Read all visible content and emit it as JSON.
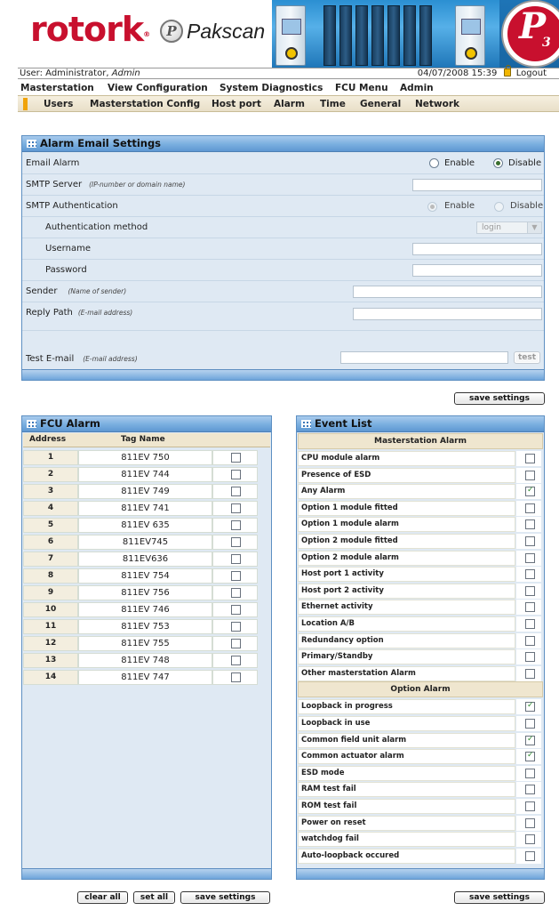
{
  "brand": {
    "rotork": "rotork",
    "pak_letter": "P",
    "pakscan": "Pakscan",
    "p3": "P",
    "p3_sub": "3"
  },
  "userbar": {
    "user_text": "User: Administrator, ",
    "user_name": "Admin",
    "datetime": "04/07/2008 15:39",
    "logout": "Logout"
  },
  "menu": [
    "Masterstation",
    "View Configuration",
    "System Diagnostics",
    "FCU Menu",
    "Admin"
  ],
  "submenu": [
    "Users",
    "Masterstation Config",
    "Host port",
    "Alarm",
    "Time",
    "General",
    "Network"
  ],
  "email": {
    "title": "Alarm Email Settings",
    "email_alarm": "Email Alarm",
    "enable": "Enable",
    "disable": "Disable",
    "smtp_server": "SMTP Server",
    "smtp_server_hint": "(IP-number or domain name)",
    "smtp_auth": "SMTP Authentication",
    "auth_method": "Authentication method",
    "auth_method_value": "login",
    "username": "Username",
    "password": "Password",
    "sender": "Sender",
    "sender_hint": "(Name of sender)",
    "reply_path": "Reply Path",
    "reply_hint": "(E-mail address)",
    "test_email": "Test E-mail",
    "test_hint": "(E-mail address)",
    "test_btn": "test",
    "email_alarm_state": "disable",
    "smtp_auth_state": "enable"
  },
  "save_settings": "save settings",
  "clear_all": "clear all",
  "set_all": "set all",
  "fcu": {
    "title": "FCU Alarm",
    "col_address": "Address",
    "col_tag": "Tag Name",
    "rows": [
      {
        "addr": "1",
        "tag": "811EV 750",
        "checked": false
      },
      {
        "addr": "2",
        "tag": "811EV 744",
        "checked": false
      },
      {
        "addr": "3",
        "tag": "811EV 749",
        "checked": false
      },
      {
        "addr": "4",
        "tag": "811EV 741",
        "checked": false
      },
      {
        "addr": "5",
        "tag": "811EV 635",
        "checked": false
      },
      {
        "addr": "6",
        "tag": "811EV745",
        "checked": false
      },
      {
        "addr": "7",
        "tag": "811EV636",
        "checked": false
      },
      {
        "addr": "8",
        "tag": "811EV 754",
        "checked": false
      },
      {
        "addr": "9",
        "tag": "811EV 756",
        "checked": false
      },
      {
        "addr": "10",
        "tag": "811EV 746",
        "checked": false
      },
      {
        "addr": "11",
        "tag": "811EV 753",
        "checked": false
      },
      {
        "addr": "12",
        "tag": "811EV 755",
        "checked": false
      },
      {
        "addr": "13",
        "tag": "811EV 748",
        "checked": false
      },
      {
        "addr": "14",
        "tag": "811EV 747",
        "checked": false
      }
    ]
  },
  "events": {
    "title": "Event List",
    "groups": [
      {
        "heading": "Masterstation Alarm",
        "items": [
          {
            "label": "CPU module alarm",
            "checked": false
          },
          {
            "label": "Presence of ESD",
            "checked": false
          },
          {
            "label": "Any Alarm",
            "checked": true
          },
          {
            "label": "Option 1 module fitted",
            "checked": false
          },
          {
            "label": "Option 1 module alarm",
            "checked": false
          },
          {
            "label": "Option 2 module fitted",
            "checked": false
          },
          {
            "label": "Option 2 module alarm",
            "checked": false
          },
          {
            "label": "Host port 1 activity",
            "checked": false
          },
          {
            "label": "Host port 2 activity",
            "checked": false
          },
          {
            "label": "Ethernet activity",
            "checked": false
          },
          {
            "label": "Location A/B",
            "checked": false
          },
          {
            "label": "Redundancy option",
            "checked": false
          },
          {
            "label": "Primary/Standby",
            "checked": false
          },
          {
            "label": "Other masterstation Alarm",
            "checked": false
          }
        ]
      },
      {
        "heading": "Option Alarm",
        "items": [
          {
            "label": "Loopback in progress",
            "checked": true
          },
          {
            "label": "Loopback in use",
            "checked": false
          },
          {
            "label": "Common field unit alarm",
            "checked": true
          },
          {
            "label": "Common actuator alarm",
            "checked": true
          },
          {
            "label": "ESD mode",
            "checked": false
          },
          {
            "label": "RAM test fail",
            "checked": false
          },
          {
            "label": "ROM test fail",
            "checked": false
          },
          {
            "label": "Power on reset",
            "checked": false
          },
          {
            "label": "watchdog fail",
            "checked": false
          },
          {
            "label": "Auto-loopback occured",
            "checked": false
          }
        ]
      }
    ]
  }
}
